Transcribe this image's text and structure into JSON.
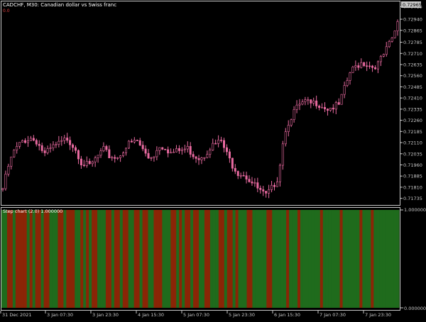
{
  "header": {
    "symbol_info": "CADCHF, M30:  Canadian dollar vs Swiss franc",
    "marker": "0.0"
  },
  "price_axis": {
    "ticks": [
      "0.73025",
      "0.72940",
      "0.72865",
      "0.72785",
      "0.72710",
      "0.72635",
      "0.72560",
      "0.72485",
      "0.72410",
      "0.72335",
      "0.72260",
      "0.72185",
      "0.72110",
      "0.72035",
      "0.71960",
      "0.71885",
      "0.71810",
      "0.71735"
    ],
    "current_price": "0.72965"
  },
  "indicator": {
    "label": "Step chart (2.0) 1.000000",
    "scale_top": "1.000000",
    "scale_bottom": "0.000000"
  },
  "time_axis": {
    "labels": [
      "31 Dec 2021",
      "3 Jan 07:30",
      "3 Jan 23:30",
      "4 Jan 15:30",
      "5 Jan 07:30",
      "5 Jan 23:30",
      "6 Jan 15:30",
      "7 Jan 07:30",
      "7 Jan 23:30"
    ]
  },
  "colors": {
    "background": "#000000",
    "candle": "#e96aa0",
    "axis": "#c8c8c8",
    "step_up": "#1f6b1c",
    "step_down": "#8a2506"
  },
  "chart_data": {
    "type": "candlestick",
    "instrument": "CADCHF",
    "timeframe": "M30",
    "ylim": [
      0.717,
      0.7305
    ],
    "close_path_knots": [
      [
        0,
        0.718
      ],
      [
        2,
        0.7195
      ],
      [
        4,
        0.7205
      ],
      [
        7,
        0.7212
      ],
      [
        10,
        0.7214
      ],
      [
        12,
        0.7212
      ],
      [
        15,
        0.7203
      ],
      [
        18,
        0.7208
      ],
      [
        21,
        0.7211
      ],
      [
        23,
        0.7214
      ],
      [
        26,
        0.7207
      ],
      [
        28,
        0.7198
      ],
      [
        31,
        0.7195
      ],
      [
        34,
        0.7202
      ],
      [
        36,
        0.7206
      ],
      [
        38,
        0.7202
      ],
      [
        41,
        0.7201
      ],
      [
        43,
        0.7206
      ],
      [
        45,
        0.721
      ],
      [
        48,
        0.7212
      ],
      [
        50,
        0.7206
      ],
      [
        52,
        0.7201
      ],
      [
        54,
        0.7203
      ],
      [
        56,
        0.7209
      ],
      [
        58,
        0.7208
      ],
      [
        60,
        0.7204
      ],
      [
        62,
        0.7205
      ],
      [
        64,
        0.7206
      ],
      [
        66,
        0.7207
      ],
      [
        68,
        0.7203
      ],
      [
        70,
        0.7201
      ],
      [
        72,
        0.7203
      ],
      [
        74,
        0.7208
      ],
      [
        76,
        0.721
      ],
      [
        78,
        0.7212
      ],
      [
        80,
        0.7203
      ],
      [
        82,
        0.7196
      ],
      [
        84,
        0.7191
      ],
      [
        86,
        0.719
      ],
      [
        88,
        0.7186
      ],
      [
        90,
        0.7182
      ],
      [
        92,
        0.7178
      ],
      [
        94,
        0.7175
      ],
      [
        96,
        0.718
      ],
      [
        98,
        0.7187
      ],
      [
        99,
        0.7197
      ],
      [
        100,
        0.7212
      ],
      [
        102,
        0.7225
      ],
      [
        104,
        0.7232
      ],
      [
        106,
        0.7236
      ],
      [
        108,
        0.7238
      ],
      [
        110,
        0.7237
      ],
      [
        112,
        0.7238
      ],
      [
        114,
        0.7236
      ],
      [
        116,
        0.7234
      ],
      [
        118,
        0.7235
      ],
      [
        120,
        0.7236
      ],
      [
        122,
        0.7247
      ],
      [
        124,
        0.7258
      ],
      [
        126,
        0.7262
      ],
      [
        128,
        0.7265
      ],
      [
        130,
        0.7264
      ],
      [
        132,
        0.7262
      ],
      [
        134,
        0.7264
      ],
      [
        136,
        0.727
      ],
      [
        138,
        0.7277
      ],
      [
        140,
        0.7285
      ],
      [
        141,
        0.7293
      ]
    ],
    "step_series": [
      1,
      1,
      0,
      0,
      1,
      0,
      0,
      0,
      0,
      1,
      0,
      1,
      0,
      0,
      1,
      0,
      0,
      1,
      1,
      1,
      0,
      0,
      1,
      0,
      0,
      0,
      1,
      1,
      0,
      1,
      0,
      1,
      0,
      0,
      1,
      1,
      1,
      0,
      0,
      1,
      0,
      0,
      1,
      0,
      0,
      1,
      1,
      0,
      0,
      1,
      0,
      0,
      1,
      1,
      0,
      0,
      0,
      1,
      1,
      1,
      0,
      0,
      1,
      0,
      1,
      0,
      0,
      1,
      0,
      0,
      1,
      1,
      0,
      0,
      1,
      1,
      1,
      0,
      0,
      1,
      0,
      0,
      1,
      0,
      1,
      1,
      1,
      0,
      0,
      1,
      1,
      1,
      1,
      1,
      0,
      0,
      1,
      1,
      1,
      1,
      1,
      0,
      1,
      1,
      1,
      0,
      1,
      1,
      1,
      1,
      1,
      1,
      1,
      0,
      1,
      1,
      1,
      1,
      1,
      1,
      0,
      1,
      1,
      1,
      1,
      1,
      1,
      0,
      1,
      1,
      1,
      0,
      1,
      1,
      1,
      1,
      1,
      1,
      1,
      1,
      1
    ]
  }
}
